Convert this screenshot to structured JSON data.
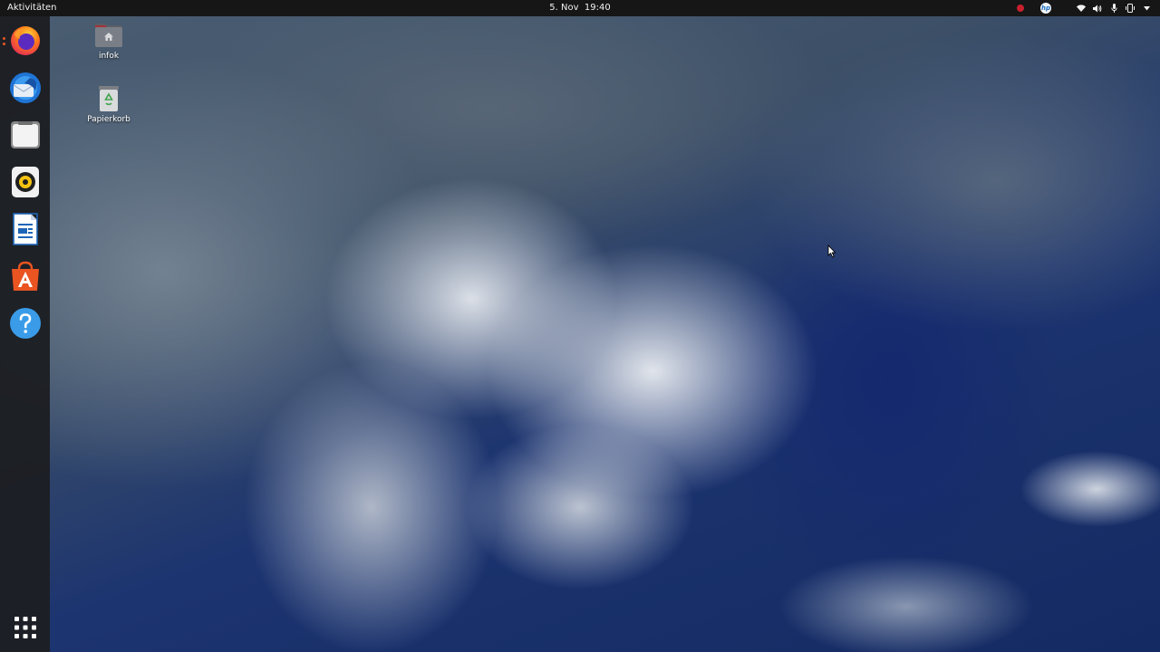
{
  "topbar": {
    "activities_label": "Aktivitäten",
    "date": "5. Nov",
    "time": "19:40",
    "tray": {
      "recording_indicator_color": "#c8202e",
      "hp_label": "hp",
      "icons": [
        "record-icon",
        "hp-icon",
        "wifi-icon",
        "volume-icon",
        "microphone-icon",
        "phone-icon",
        "chevron-down-icon"
      ]
    }
  },
  "dock": {
    "apps": [
      {
        "name": "Firefox",
        "icon": "firefox-icon",
        "running": true
      },
      {
        "name": "Thunderbird",
        "icon": "thunderbird-icon",
        "running": false
      },
      {
        "name": "Dateien",
        "icon": "files-icon",
        "running": false
      },
      {
        "name": "Rhythmbox",
        "icon": "rhythmbox-icon",
        "running": false
      },
      {
        "name": "LibreOffice Writer",
        "icon": "writer-icon",
        "running": false
      },
      {
        "name": "Ubuntu Software",
        "icon": "software-icon",
        "running": false
      },
      {
        "name": "Hilfe",
        "icon": "help-icon",
        "running": false
      }
    ],
    "show_apps_icon": "app-grid-icon"
  },
  "desktop": {
    "icons": [
      {
        "label": "infok",
        "icon": "home-folder-icon"
      },
      {
        "label": "Papierkorb",
        "icon": "trash-icon"
      }
    ]
  },
  "colors": {
    "topbar_bg": "#161616",
    "dock_bg": "#1c1e22",
    "accent": "#e95420"
  }
}
